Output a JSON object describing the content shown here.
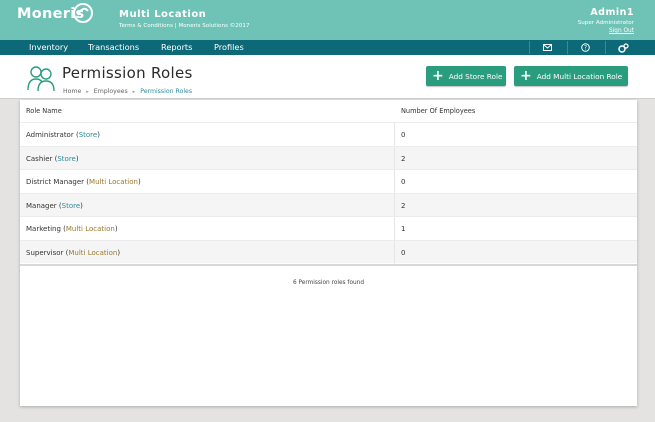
{
  "topbar": {
    "brand": "Moneris",
    "app_title": "Multi  Location",
    "app_subtitle": "Terms & Conditions | Moneris Solutions ©2017",
    "user_name": "Admin1",
    "user_role": "Super Administrator",
    "sign_out": "Sign Out"
  },
  "nav": {
    "items": [
      "Inventory",
      "Transactions",
      "Reports",
      "Profiles"
    ],
    "icons": [
      "mail-icon",
      "help-icon",
      "settings-icon"
    ]
  },
  "header": {
    "title": "Permission  Roles",
    "breadcrumb": [
      "Home",
      "Employees",
      "Permission Roles"
    ],
    "add_store_role": "Add Store Role",
    "add_multi_location_role": "Add Multi Location Role"
  },
  "table": {
    "columns": [
      "Role Name",
      "Number Of Employees"
    ],
    "rows": [
      {
        "name": "Administrator",
        "scope": "Store",
        "count": "0"
      },
      {
        "name": "Cashier",
        "scope": "Store",
        "count": "2"
      },
      {
        "name": "District Manager",
        "scope": "Multi Location",
        "count": "0"
      },
      {
        "name": "Manager",
        "scope": "Store",
        "count": "2"
      },
      {
        "name": "Marketing",
        "scope": "Multi Location",
        "count": "1"
      },
      {
        "name": "Supervisor",
        "scope": "Multi Location",
        "count": "0"
      }
    ],
    "footer": "6 Permission roles found"
  },
  "colors": {
    "topbar": "#6fc3b6",
    "navbar": "#0d6977",
    "button": "#2a9d7e",
    "store_link": "#2c8a9a",
    "multi_link": "#9a7a2c"
  }
}
